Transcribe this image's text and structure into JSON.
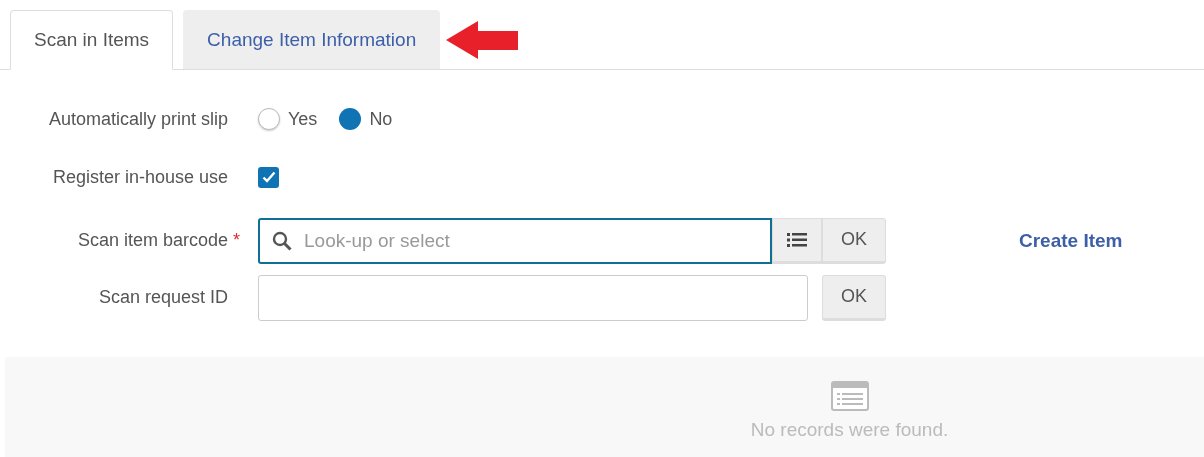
{
  "tabs": [
    {
      "label": "Scan in Items",
      "selected": true
    },
    {
      "label": "Change Item Information",
      "selected": false
    }
  ],
  "form": [
    {
      "kind": "radio",
      "label": "Automatically print slip",
      "options": [
        {
          "label": "Yes",
          "selected": false
        },
        {
          "label": "No",
          "selected": true
        }
      ]
    },
    {
      "kind": "checkbox",
      "label": "Register in-house use",
      "checked": true
    },
    {
      "kind": "search",
      "label": "Scan item barcode",
      "required_mark": "*",
      "placeholder": "Look-up or select",
      "button": "OK",
      "link": "Create Item"
    },
    {
      "kind": "text",
      "label": "Scan request ID",
      "button": "OK"
    }
  ],
  "results": {
    "message": "No records were found."
  }
}
